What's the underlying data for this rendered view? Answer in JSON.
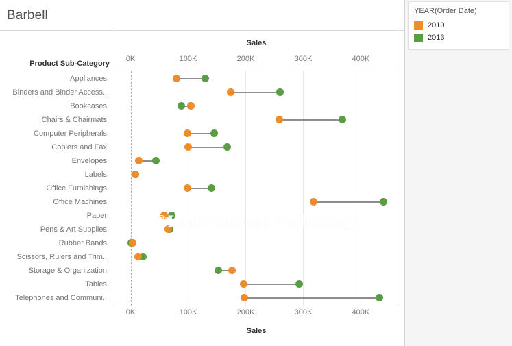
{
  "title": "Barbell",
  "row_field_header": "Product Sub-Category",
  "watermark": "©LearnTableau Technology",
  "legend": {
    "title": "YEAR(Order Date)",
    "items": [
      {
        "label": "2010",
        "color": "#ED8C2B"
      },
      {
        "label": "2013",
        "color": "#5A9E44"
      }
    ]
  },
  "colors": {
    "series_2010": "#ED8C2B",
    "series_2013": "#5A9E44",
    "connector": "#8E8E8E",
    "gridline": "#E8E8E8",
    "axis_text": "#777777",
    "header_text": "#333333",
    "title_text": "#4E4E4E"
  },
  "chart_data": {
    "type": "scatter",
    "subtype": "barbell",
    "title": "Barbell",
    "xlabel": "Sales",
    "ylabel": "Product Sub-Category",
    "axis_title_top": "Sales",
    "axis_title_bottom": "Sales",
    "grid": true,
    "legend_position": "right",
    "xlim": [
      -28000,
      465000
    ],
    "xticks": [
      0,
      100000,
      200000,
      300000,
      400000
    ],
    "xtick_labels": [
      "0K",
      "100K",
      "200K",
      "300K",
      "400K"
    ],
    "reference_line": 0,
    "categories": [
      "Appliances",
      "Binders and Binder Access..",
      "Bookcases",
      "Chairs & Chairmats",
      "Computer Peripherals",
      "Copiers and Fax",
      "Envelopes",
      "Labels",
      "Office Furnishings",
      "Office Machines",
      "Paper",
      "Pens & Art Supplies",
      "Rubber Bands",
      "Scissors, Rulers and Trim..",
      "Storage & Organization",
      "Tables",
      "Telephones and Communi.."
    ],
    "series": [
      {
        "name": "2010",
        "color": "#ED8C2B",
        "values": [
          80000,
          174000,
          105000,
          258000,
          99000,
          100000,
          14000,
          8000,
          99000,
          318000,
          58000,
          65000,
          4000,
          13000,
          176000,
          196000,
          198000
        ]
      },
      {
        "name": "2013",
        "color": "#5A9E44",
        "values": [
          130000,
          260000,
          88000,
          368000,
          145000,
          168000,
          44000,
          8000,
          140000,
          439000,
          72000,
          68000,
          1000,
          22000,
          153000,
          293000,
          432000
        ]
      }
    ]
  }
}
